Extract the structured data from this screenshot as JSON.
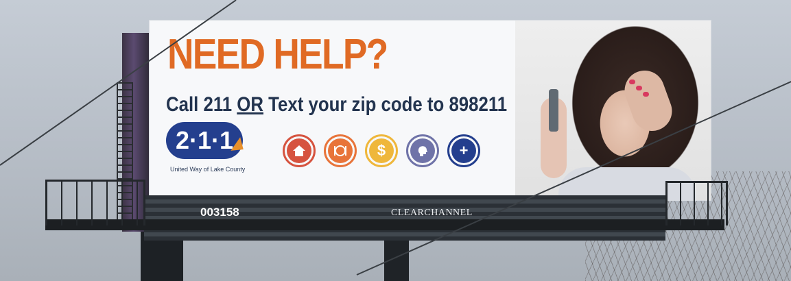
{
  "billboard": {
    "headline": "NEED HELP?",
    "subline_before": "Call 211",
    "subline_or": "OR",
    "subline_after": "Text your zip code to 898211",
    "logo_text": "2·1·1",
    "logo_caption": "United Way of Lake County",
    "icons": [
      "home-icon",
      "food-icon",
      "dollar-icon",
      "mental-health-icon",
      "medical-plus-icon"
    ],
    "icon_colors": [
      "#d6533f",
      "#e8743a",
      "#efb73b",
      "#6f73a8",
      "#243f8e"
    ]
  },
  "structure": {
    "panel_id": "003158",
    "vendor": "CLEARCHANNEL"
  },
  "colors": {
    "headline": "#e06a24",
    "subline": "#23344f",
    "logo_blue": "#243f8e",
    "sky": "#b9c0c9"
  }
}
